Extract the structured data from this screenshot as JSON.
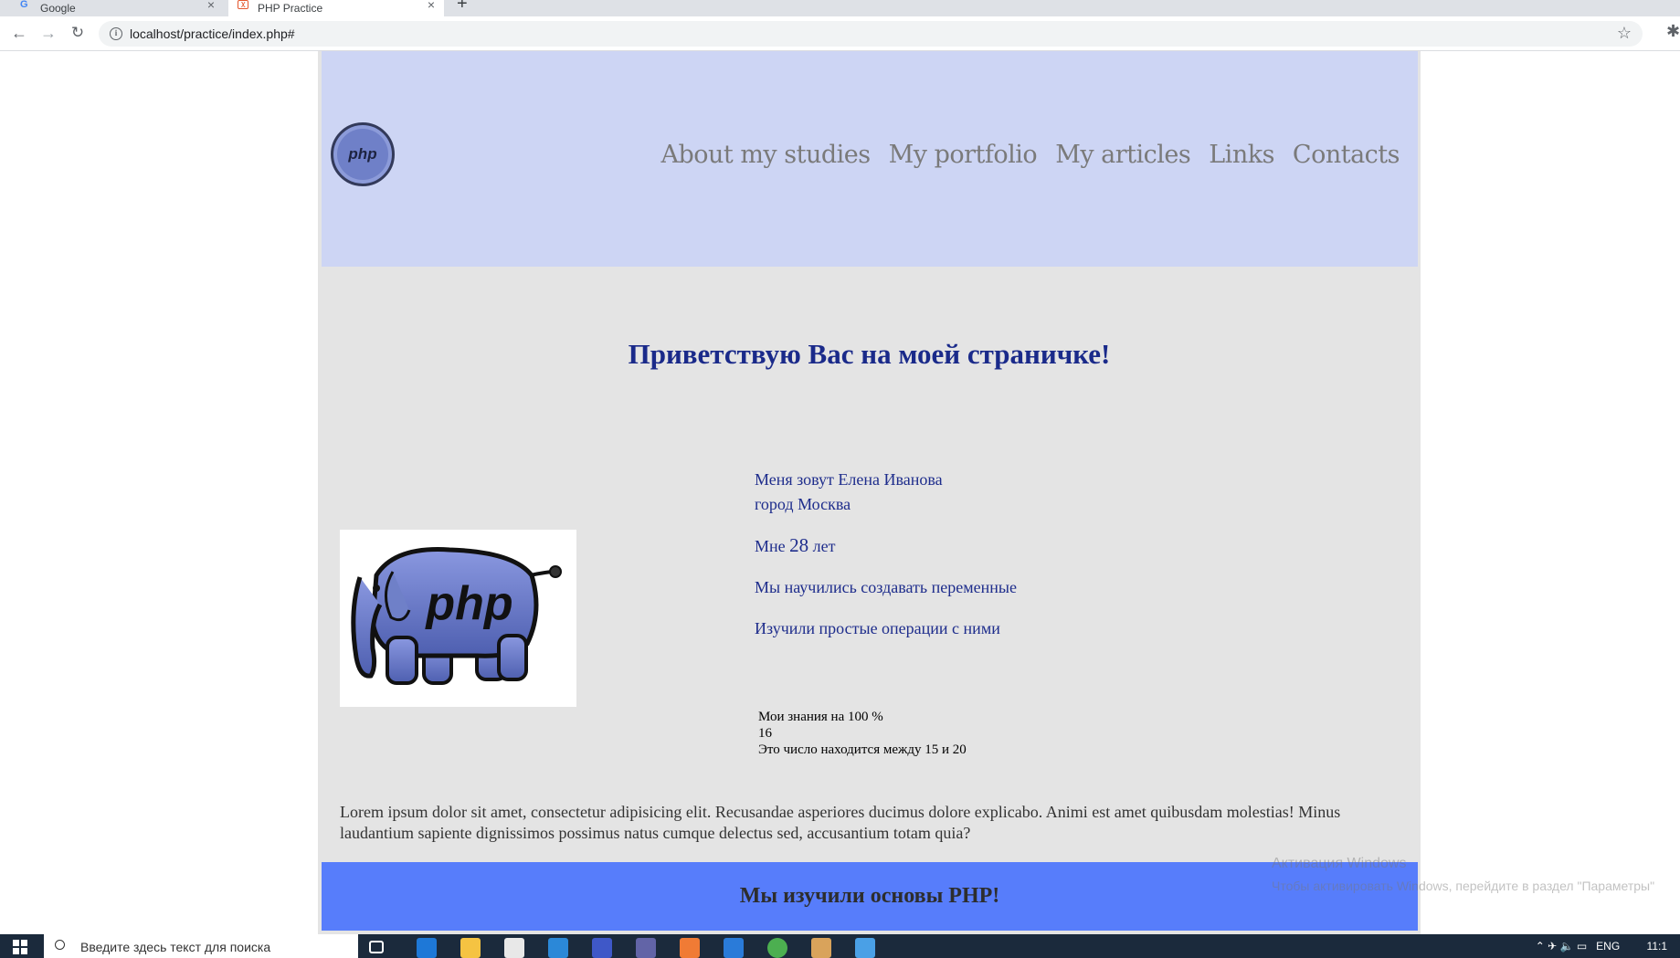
{
  "browser": {
    "tabs": [
      {
        "title": "Google",
        "active": false
      },
      {
        "title": "PHP Practice",
        "active": true
      }
    ],
    "url": "localhost/practice/index.php#"
  },
  "header": {
    "logo_text": "php",
    "nav": [
      "About my studies",
      "My portfolio",
      "My articles",
      "Links",
      "Contacts"
    ]
  },
  "main": {
    "greeting": "Приветствую Вас на моей страничке!",
    "elephant_text": "php",
    "name_line": "Меня зовут Елена Иванова",
    "city_line": "город Москва",
    "age_prefix": "Мне",
    "age_value": "28",
    "age_suffix": "лет",
    "variables_line": "Мы научились создавать переменные",
    "operations_line": "Изучили простые операции с ними",
    "knowledge_line": "Мои знания на 100 %",
    "number_line": "16",
    "range_line": "Это число находится между 15 и 20",
    "lorem": "Lorem ipsum dolor sit amet, consectetur adipisicing elit. Recusandae asperiores ducimus dolore explicabo. Animi est amet quibusdam molestias! Minus laudantium sapiente dignissimos possimus natus cumque delectus sed, accusantium totam quia?"
  },
  "footer": {
    "text": "Мы изучили основы PHP!"
  },
  "watermark": {
    "line1": "Активация Windows",
    "line2": "Чтобы активировать Windows, перейдите в раздел \"Параметры\""
  },
  "taskbar": {
    "search_placeholder": "Введите здесь текст для поиска",
    "language": "ENG",
    "clock": "11:1"
  },
  "colors": {
    "header_bg": "#cdd5f4",
    "page_bg": "#e4e4e4",
    "greeting": "#1a2a8a",
    "footer_bg": "#577dfb"
  }
}
